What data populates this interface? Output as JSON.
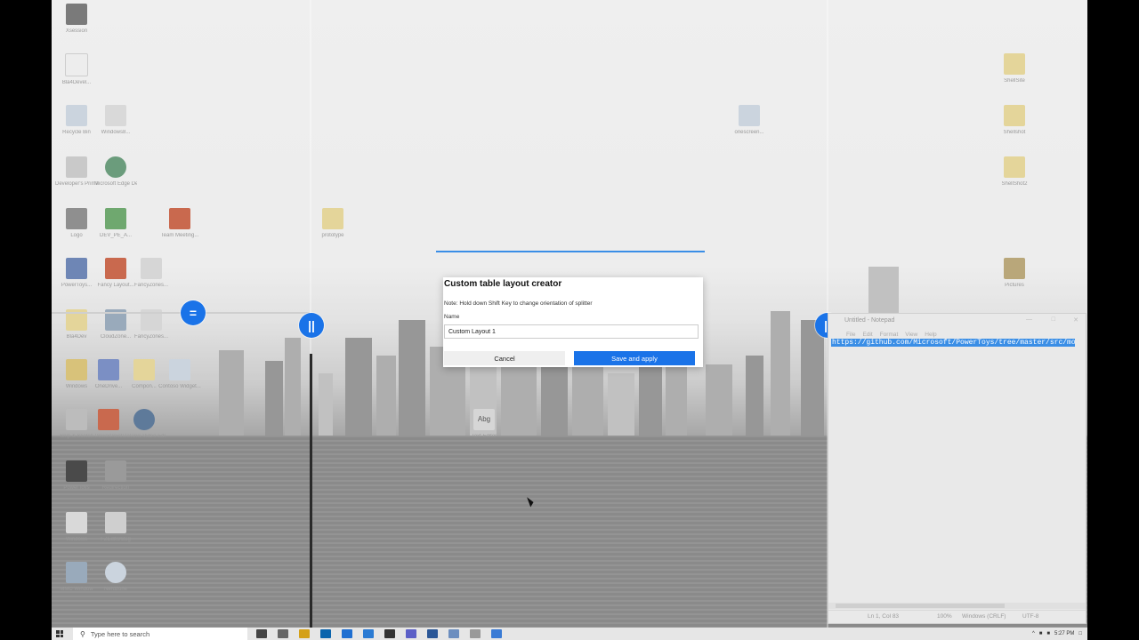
{
  "desktop": {
    "icons": [
      {
        "label": "Xsession",
        "color": "#7a7a7a"
      },
      {
        "label": "Bla4Devel...",
        "color": "#ededed"
      },
      {
        "label": "Recycle Bin",
        "color": "#cbd4de"
      },
      {
        "label": "Windows8...",
        "color": "#d9d9d9"
      },
      {
        "label": "Developer's Primary Kit",
        "color": "#c9c9c9"
      },
      {
        "label": "Microsoft Edge Dev",
        "color": "#6b9c7c"
      },
      {
        "label": "Logo",
        "color": "#8f8f8f"
      },
      {
        "label": "DEV_PE_A...",
        "color": "#6fa86f"
      },
      {
        "label": "Team Meeting...",
        "color": "#c9694e"
      },
      {
        "label": "prototype",
        "color": "#e4d59a"
      },
      {
        "label": "PowerToys...",
        "color": "#6e86b5"
      },
      {
        "label": "Fancy Layout...",
        "color": "#c9694e"
      },
      {
        "label": "FancyZones...",
        "color": "#d6d6d6"
      },
      {
        "label": "Bla4Dev",
        "color": "#e4d59a"
      },
      {
        "label": "CloudZone...",
        "color": "#9ab"
      },
      {
        "label": "FancyZones...",
        "color": "#d6d6d6"
      },
      {
        "label": "Windows",
        "color": "#d8c27a"
      },
      {
        "label": "OneDrive...",
        "color": "#7b8fc4"
      },
      {
        "label": "Compon...",
        "color": "#e4d59a"
      },
      {
        "label": "Contoso Widget...",
        "color": "#cbd4de"
      },
      {
        "label": "Snip & Sketch",
        "color": "#bcbcbc"
      },
      {
        "label": "PowerPoint",
        "color": "#c9694e"
      },
      {
        "label": "DaVinci Video Editor",
        "color": "#5e7a9a"
      },
      {
        "label": "PowerToys",
        "color": "#4a4a4a"
      },
      {
        "label": "Redirection",
        "color": "#9a9a9a"
      },
      {
        "label": "Windows",
        "color": "#d9d9d9"
      },
      {
        "label": "FZEditorBug",
        "color": "#cfcfcf"
      },
      {
        "label": "MMC Window",
        "color": "#9ab"
      },
      {
        "label": "Nerdzone",
        "color": "#cbd4de"
      },
      {
        "label": "onescreen...",
        "color": "#cbd4de"
      },
      {
        "label": "ShellSite",
        "color": "#e4d59a"
      },
      {
        "label": "Shellshot",
        "color": "#e4d59a"
      },
      {
        "label": "ShellShot2",
        "color": "#e4d59a"
      },
      {
        "label": "Pictures",
        "color": "#b9a77a"
      },
      {
        "label": "Abg",
        "color": "#d6d6d6"
      },
      {
        "label": "Text Editor",
        "color": "#d6d6d6"
      }
    ],
    "handles": {
      "horizontal": "=",
      "vertical": "||"
    }
  },
  "dialog": {
    "title": "Custom table layout creator",
    "note": "Note: Hold down Shift Key to change orientation of splitter",
    "name_label": "Name",
    "name_value": "Custom Layout 1",
    "cancel_label": "Cancel",
    "save_label": "Save and apply"
  },
  "notepad": {
    "title": "Untitled - Notepad",
    "menu": [
      "File",
      "Edit",
      "Format",
      "View",
      "Help"
    ],
    "content": "https://github.com/Microsoft/PowerToys/tree/master/src/modules",
    "status_position": "Ln 1, Col 83",
    "status_zoom": "100%",
    "status_eol": "Windows (CRLF)",
    "status_encoding": "UTF-8"
  },
  "taskbar": {
    "search_placeholder": "Type here to search",
    "time": "5:27 PM",
    "app_colors": [
      "#444",
      "#666",
      "#d4a017",
      "#0a64ad",
      "#1f6fd1",
      "#2b7bd3",
      "#333",
      "#5b5fc7",
      "#2b5797",
      "#6c8ebf",
      "#999",
      "#3a7bd5"
    ]
  },
  "colors": {
    "accent": "#1a73e8"
  }
}
